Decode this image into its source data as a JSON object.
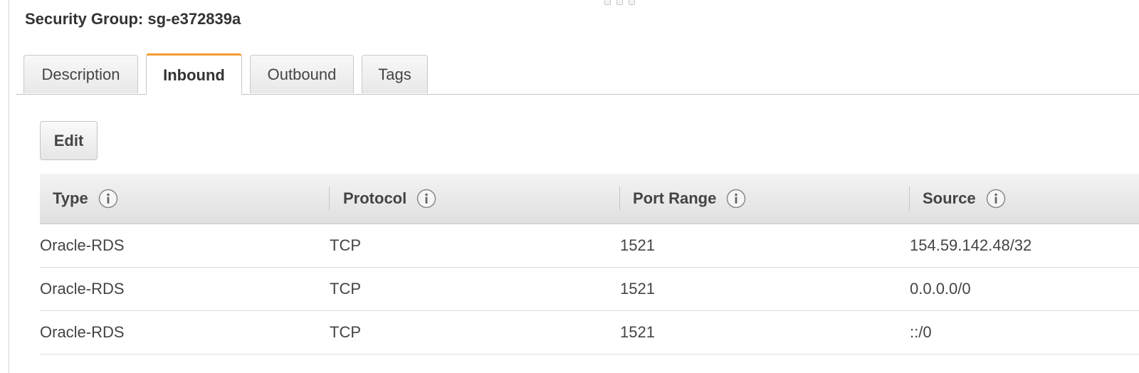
{
  "panel": {
    "title": "Security Group: sg-e372839a"
  },
  "tabs": [
    {
      "label": "Description",
      "active": false
    },
    {
      "label": "Inbound",
      "active": true
    },
    {
      "label": "Outbound",
      "active": false
    },
    {
      "label": "Tags",
      "active": false
    }
  ],
  "toolbar": {
    "edit_label": "Edit"
  },
  "table": {
    "columns": [
      {
        "label": "Type",
        "icon": "info-icon"
      },
      {
        "label": "Protocol",
        "icon": "info-icon"
      },
      {
        "label": "Port Range",
        "icon": "info-icon"
      },
      {
        "label": "Source",
        "icon": "info-icon"
      }
    ],
    "rows": [
      [
        "Oracle-RDS",
        "TCP",
        "1521",
        "154.59.142.48/32"
      ],
      [
        "Oracle-RDS",
        "TCP",
        "1521",
        "0.0.0.0/0"
      ],
      [
        "Oracle-RDS",
        "TCP",
        "1521",
        "::/0"
      ]
    ]
  },
  "colors": {
    "active_tab_accent": "#f39c32"
  }
}
